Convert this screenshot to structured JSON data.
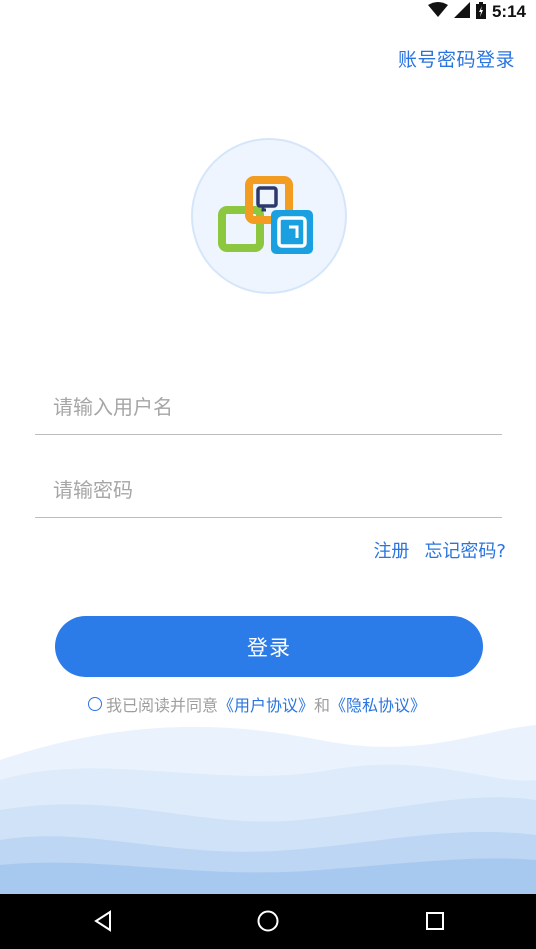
{
  "status_bar": {
    "time": "5:14",
    "icons": [
      "wifi-icon",
      "signal-icon",
      "battery-icon"
    ]
  },
  "header": {
    "account_login_label": "账号密码登录"
  },
  "logo": {
    "icon": "app-logo-icon",
    "colors": {
      "green": "#8dc63f",
      "orange": "#f39c22",
      "blue": "#1aa0e0",
      "navy": "#2b3a6b"
    }
  },
  "form": {
    "username_placeholder": "请输入用户名",
    "password_placeholder": "请输密码",
    "register_label": "注册",
    "forgot_password_label": "忘记密码?",
    "login_button_label": "登录"
  },
  "agreement": {
    "prefix": "我已阅读并同意",
    "user_agreement": "《用户协议》",
    "and": "和",
    "privacy_policy": "《隐私协议》"
  },
  "nav_bar": {
    "icons": [
      "back-icon",
      "home-icon",
      "recents-icon"
    ]
  },
  "colors": {
    "accent": "#2b7be9",
    "link": "#2a74e0",
    "placeholder": "#a6a6a6"
  }
}
